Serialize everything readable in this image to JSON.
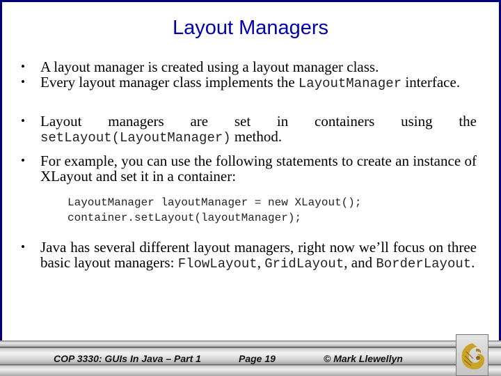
{
  "slide": {
    "title": "Layout Managers",
    "bullets": [
      {
        "id": 1,
        "parts": [
          {
            "t": "A layout manager is created using a layout manager class."
          }
        ]
      },
      {
        "id": 2,
        "parts": [
          {
            "t": "Every layout manager class implements the "
          },
          {
            "code": "LayoutManager"
          },
          {
            "t": " interface."
          }
        ]
      },
      {
        "id": 3,
        "parts": [
          {
            "t": "Layout managers are set in containers using the "
          },
          {
            "code": "setLayout(LayoutManager)"
          },
          {
            "t": " method."
          }
        ]
      },
      {
        "id": 4,
        "parts": [
          {
            "t": "For example, you can use the following statements to create an instance of XLayout and set it in a container:"
          }
        ]
      },
      {
        "id": 5,
        "parts": [
          {
            "t": "Java has several different layout managers, right now we’ll focus on three basic layout managers: "
          },
          {
            "code": "FlowLayout"
          },
          {
            "t": ", "
          },
          {
            "code": "GridLayout"
          },
          {
            "t": ", and "
          },
          {
            "code": "BorderLayout"
          },
          {
            "t": "."
          }
        ]
      }
    ],
    "bullet_glyph": "•",
    "code_lines": [
      "LayoutManager layoutManager = new XLayout();",
      "container.setLayout(layoutManager);"
    ]
  },
  "footer": {
    "course": "COP 3330:  GUIs In Java – Part 1",
    "page": "Page 19",
    "author": "© Mark Llewellyn",
    "logo_icon": "ucf-pegasus-logo"
  },
  "colors": {
    "frame": "#000080",
    "title": "#0000b0",
    "logo_gold": "#c9a227"
  }
}
